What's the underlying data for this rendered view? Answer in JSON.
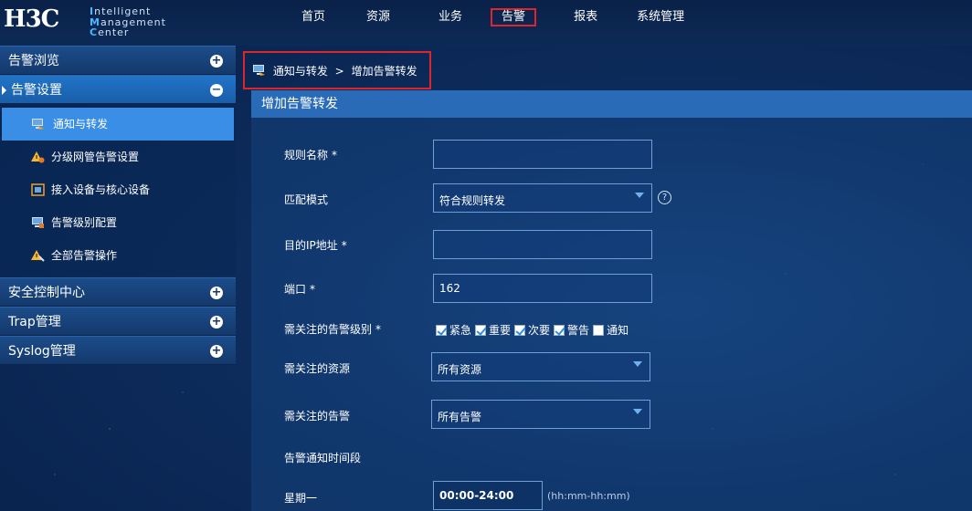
{
  "logo": {
    "mark": "H3C",
    "line1": "ntelligent",
    "line1_cap": "I",
    "line2a_cap": "M",
    "line2a": "anagement ",
    "line2b_cap": "C",
    "line2b": "enter"
  },
  "nav": {
    "items": [
      "首页",
      "资源",
      "业务",
      "告警",
      "报表",
      "系统管理"
    ],
    "active": "告警"
  },
  "sidebar": {
    "alarm_browse": "告警浏览",
    "alarm_settings": "告警设置",
    "sub_items": [
      {
        "label": "通知与转发",
        "icon": "monitor-arrow-icon"
      },
      {
        "label": "分级网管告警设置",
        "icon": "warning-gear-icon"
      },
      {
        "label": "接入设备与核心设备",
        "icon": "device-link-icon"
      },
      {
        "label": "告警级别配置",
        "icon": "monitor-list-icon"
      },
      {
        "label": "全部告警操作",
        "icon": "warning-wrench-icon"
      }
    ],
    "security_center": "安全控制中心",
    "trap": "Trap管理",
    "syslog": "Syslog管理",
    "expand_symbol": "+",
    "collapse_symbol": "−"
  },
  "breadcrumb": {
    "parent": "通知与转发",
    "separator": ">",
    "current": "增加告警转发"
  },
  "form": {
    "title": "增加告警转发",
    "rule_name_label": "规则名称",
    "rule_name_value": "",
    "match_mode_label": "匹配模式",
    "match_mode_value": "符合规则转发",
    "dest_ip_label": "目的IP地址",
    "dest_ip_value": "",
    "port_label": "端口",
    "port_value": "162",
    "levels_label": "需关注的告警级别",
    "levels": [
      {
        "label": "紧急",
        "checked": true
      },
      {
        "label": "重要",
        "checked": true
      },
      {
        "label": "次要",
        "checked": true
      },
      {
        "label": "警告",
        "checked": true
      },
      {
        "label": "通知",
        "checked": false
      }
    ],
    "resource_label": "需关注的资源",
    "resource_value": "所有资源",
    "alarm_label": "需关注的告警",
    "alarm_value": "所有告警",
    "time_section_label": "告警通知时间段",
    "monday_label": "星期一",
    "monday_value": "00:00-24:00",
    "time_hint": "(hh:mm-hh:mm)",
    "required_mark": "*",
    "help_symbol": "?"
  },
  "colors": {
    "accent": "#2a6bb8",
    "active_item": "#3b8ee6",
    "highlight_border": "#e0242c"
  }
}
